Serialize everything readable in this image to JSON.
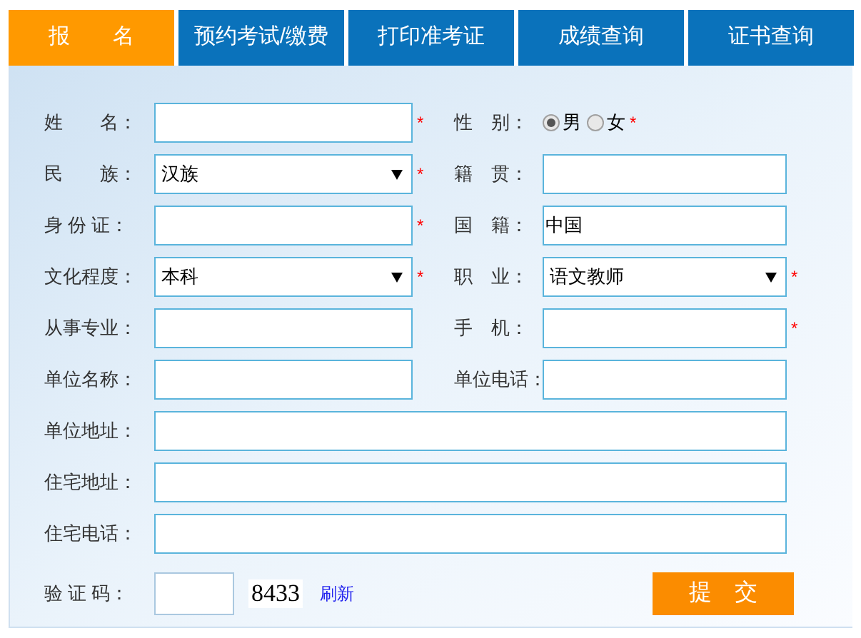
{
  "tabs": [
    {
      "label": "报　　名",
      "selected": true
    },
    {
      "label": "预约考试/缴费",
      "selected": false
    },
    {
      "label": "打印准考证",
      "selected": false
    },
    {
      "label": "成绩查询",
      "selected": false
    },
    {
      "label": "证书查询",
      "selected": false
    }
  ],
  "rows": [
    [
      {
        "kind": "text",
        "label": "姓　　名：",
        "required_mark": "*"
      },
      {
        "kind": "radio",
        "label": "性　别：",
        "options": [
          {
            "label": "男",
            "selected": true
          },
          {
            "label": "女",
            "selected": false
          }
        ],
        "required_mark": "*"
      }
    ],
    [
      {
        "kind": "select",
        "label": "民　　族：",
        "value": "汉族",
        "required_mark": "*"
      },
      {
        "kind": "text",
        "label": "籍　贯："
      }
    ],
    [
      {
        "kind": "text",
        "label": "身 份 证：",
        "required_mark": "*"
      },
      {
        "kind": "text",
        "label": "国　籍：",
        "value": "中国"
      }
    ],
    [
      {
        "kind": "select",
        "label": "文化程度：",
        "value": "本科",
        "required_mark": "*"
      },
      {
        "kind": "select",
        "label": "职　业：",
        "value": "语文教师",
        "required_mark": "*"
      }
    ],
    [
      {
        "kind": "text",
        "label": "从事专业："
      },
      {
        "kind": "text",
        "label": "手　机：",
        "required_mark": "*"
      }
    ],
    [
      {
        "kind": "text",
        "label": "单位名称："
      },
      {
        "kind": "text",
        "label": "单位电话："
      }
    ],
    [
      {
        "kind": "text",
        "label": "单位地址："
      }
    ],
    [
      {
        "kind": "text",
        "label": "住宅地址："
      }
    ],
    [
      {
        "kind": "text",
        "label": "住宅电话："
      }
    ]
  ],
  "captcha": {
    "label": "验 证 码：",
    "code": "8433",
    "refresh_link": "刷新"
  },
  "submit_button": "提　交"
}
